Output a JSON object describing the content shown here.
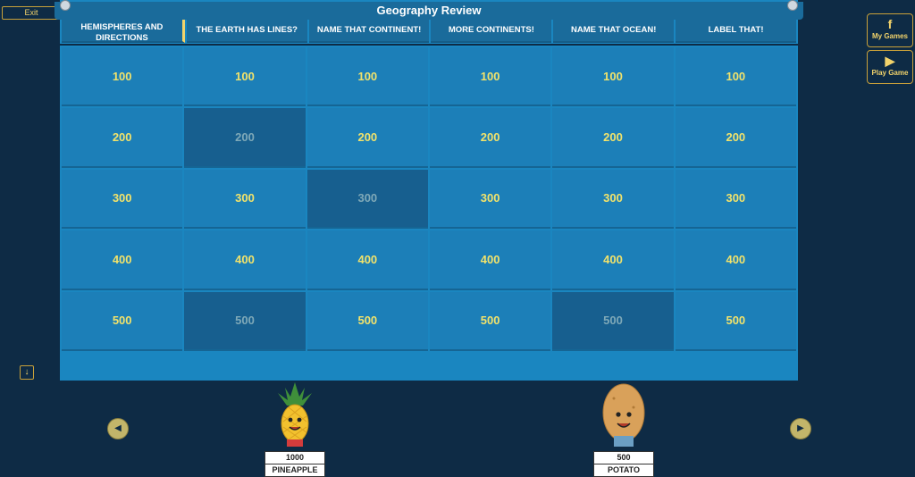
{
  "exit_label": "Exit",
  "title": "Geography Review",
  "categories": [
    "HEMISPHERES AND DIRECTIONS",
    "THE EARTH HAS LINES?",
    "NAME THAT CONTINENT!",
    "MORE CONTINENTS!",
    "NAME THAT OCEAN!",
    "LABEL THAT!"
  ],
  "rows": [
    [
      "100",
      "100",
      "100",
      "100",
      "100",
      "100"
    ],
    [
      "200",
      "200",
      "200",
      "200",
      "200",
      "200"
    ],
    [
      "300",
      "300",
      "300",
      "300",
      "300",
      "300"
    ],
    [
      "400",
      "400",
      "400",
      "400",
      "400",
      "400"
    ],
    [
      "500",
      "500",
      "500",
      "500",
      "500",
      "500"
    ]
  ],
  "used_cells": [
    "1-1",
    "2-2",
    "4-1",
    "4-4"
  ],
  "side_buttons": {
    "my_games": "My Games",
    "play_game": "Play Game"
  },
  "icons": {
    "facebook": "f",
    "play": "▶",
    "down": "↓",
    "left": "◀",
    "right": "▶"
  },
  "players": [
    {
      "score": "1000",
      "name": "PINEAPPLE"
    },
    {
      "score": "500",
      "name": "POTATO"
    }
  ],
  "colors": {
    "background": "#0e2b45",
    "board": "#1a86c0",
    "value_text": "#f2e36b",
    "accent": "#c9a13a"
  }
}
